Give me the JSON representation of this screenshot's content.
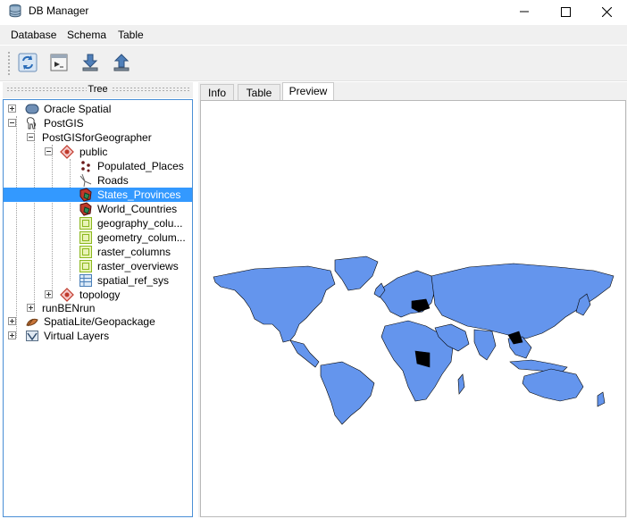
{
  "window": {
    "title": "DB Manager"
  },
  "menu": [
    {
      "label": "Database"
    },
    {
      "label": "Schema"
    },
    {
      "label": "Table"
    }
  ],
  "toolbar": {
    "buttons": [
      {
        "icon": "refresh-icon"
      },
      {
        "icon": "sql-window-icon"
      },
      {
        "icon": "import-layer-icon"
      },
      {
        "icon": "export-icon"
      }
    ]
  },
  "tree": {
    "dock_title": "Tree",
    "items": [
      {
        "label": "Oracle Spatial",
        "icon": "oracle-icon"
      },
      {
        "label": "PostGIS",
        "icon": "postgis-elephant-icon"
      },
      {
        "label": "PostGISforGeographer"
      },
      {
        "label": "public",
        "icon": "schema-icon"
      },
      {
        "label": "Populated_Places",
        "icon": "point-layer-icon"
      },
      {
        "label": "Roads",
        "icon": "line-layer-icon"
      },
      {
        "label": "States_Provinces",
        "icon": "polygon-layer-icon",
        "selected": true
      },
      {
        "label": "World_Countries",
        "icon": "polygon-layer-icon"
      },
      {
        "label": "geography_colu...",
        "icon": "table-icon"
      },
      {
        "label": "geometry_colum...",
        "icon": "table-icon"
      },
      {
        "label": "raster_columns",
        "icon": "table-icon"
      },
      {
        "label": "raster_overviews",
        "icon": "table-icon"
      },
      {
        "label": "spatial_ref_sys",
        "icon": "grid-table-icon"
      },
      {
        "label": "topology",
        "icon": "schema-icon"
      },
      {
        "label": "runBENrun"
      },
      {
        "label": "SpatiaLite/Geopackage",
        "icon": "spatialite-icon"
      },
      {
        "label": "Virtual Layers",
        "icon": "virtual-layer-icon"
      }
    ]
  },
  "tabs": [
    {
      "label": "Info"
    },
    {
      "label": "Table"
    },
    {
      "label": "Preview",
      "active": true
    }
  ],
  "preview": {
    "map_fill": "#6495ed",
    "map_stroke": "#000000"
  },
  "colors": {
    "selection": "#3399ff",
    "tree_border": "#4a8fd6",
    "chrome": "#f0f0f0"
  }
}
